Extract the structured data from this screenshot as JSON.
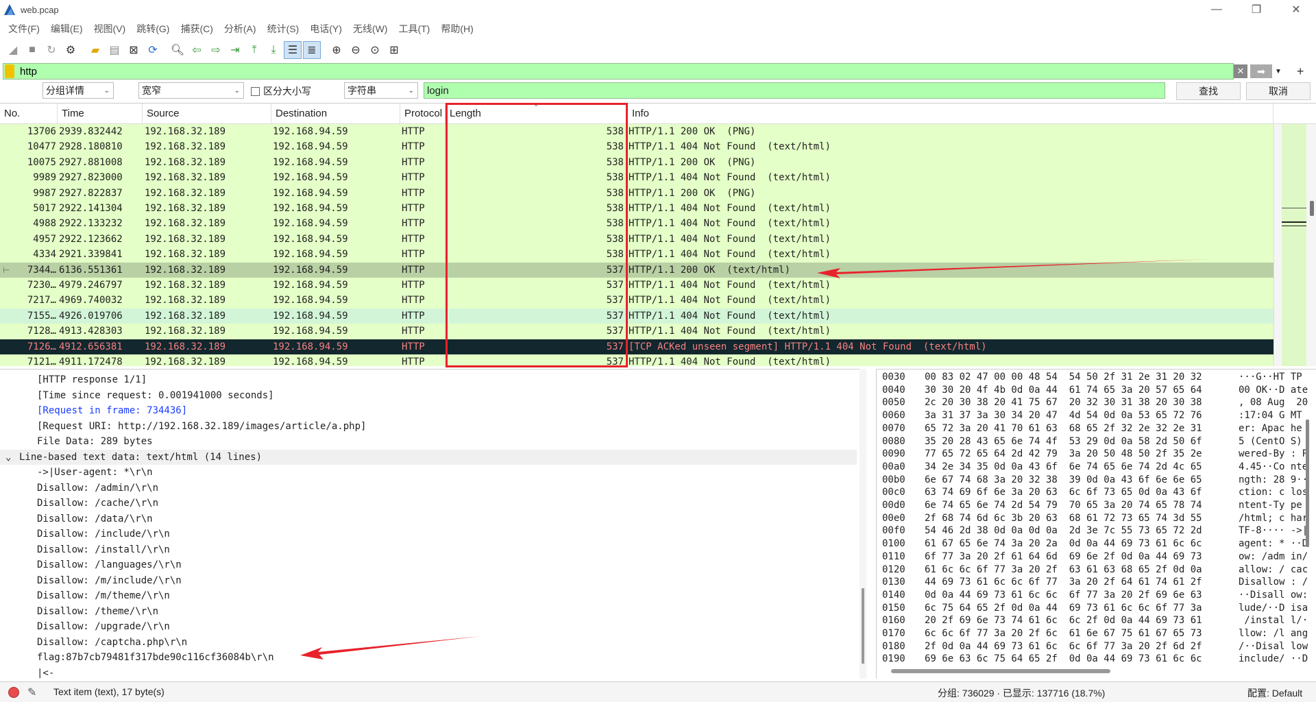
{
  "window": {
    "title": "web.pcap"
  },
  "menu": [
    "文件(F)",
    "编辑(E)",
    "视图(V)",
    "跳转(G)",
    "捕获(C)",
    "分析(A)",
    "统计(S)",
    "电话(Y)",
    "无线(W)",
    "工具(T)",
    "帮助(H)"
  ],
  "filter": {
    "value": "http"
  },
  "find": {
    "scope": "分组详情",
    "charset": "宽窄",
    "case_label": "区分大小写",
    "type": "字符串",
    "value": "login",
    "find_button": "查找",
    "cancel_button": "取消"
  },
  "packet_list": {
    "columns": [
      "No.",
      "Time",
      "Source",
      "Destination",
      "Protocol",
      "Length",
      "Info"
    ],
    "rows": [
      {
        "no": "13706",
        "time": "2939.832442",
        "src": "192.168.32.189",
        "dst": "192.168.94.59",
        "proto": "HTTP",
        "len": "538",
        "info": "HTTP/1.1 200 OK  (PNG)"
      },
      {
        "no": "10477",
        "time": "2928.180810",
        "src": "192.168.32.189",
        "dst": "192.168.94.59",
        "proto": "HTTP",
        "len": "538",
        "info": "HTTP/1.1 404 Not Found  (text/html)"
      },
      {
        "no": "10075",
        "time": "2927.881008",
        "src": "192.168.32.189",
        "dst": "192.168.94.59",
        "proto": "HTTP",
        "len": "538",
        "info": "HTTP/1.1 200 OK  (PNG)"
      },
      {
        "no": "9989",
        "time": "2927.823000",
        "src": "192.168.32.189",
        "dst": "192.168.94.59",
        "proto": "HTTP",
        "len": "538",
        "info": "HTTP/1.1 404 Not Found  (text/html)"
      },
      {
        "no": "9987",
        "time": "2927.822837",
        "src": "192.168.32.189",
        "dst": "192.168.94.59",
        "proto": "HTTP",
        "len": "538",
        "info": "HTTP/1.1 200 OK  (PNG)"
      },
      {
        "no": "5017",
        "time": "2922.141304",
        "src": "192.168.32.189",
        "dst": "192.168.94.59",
        "proto": "HTTP",
        "len": "538",
        "info": "HTTP/1.1 404 Not Found  (text/html)"
      },
      {
        "no": "4988",
        "time": "2922.133232",
        "src": "192.168.32.189",
        "dst": "192.168.94.59",
        "proto": "HTTP",
        "len": "538",
        "info": "HTTP/1.1 404 Not Found  (text/html)"
      },
      {
        "no": "4957",
        "time": "2922.123662",
        "src": "192.168.32.189",
        "dst": "192.168.94.59",
        "proto": "HTTP",
        "len": "538",
        "info": "HTTP/1.1 404 Not Found  (text/html)"
      },
      {
        "no": "4334",
        "time": "2921.339841",
        "src": "192.168.32.189",
        "dst": "192.168.94.59",
        "proto": "HTTP",
        "len": "538",
        "info": "HTTP/1.1 404 Not Found  (text/html)"
      },
      {
        "no": "7344…",
        "time": "6136.551361",
        "src": "192.168.32.189",
        "dst": "192.168.94.59",
        "proto": "HTTP",
        "len": "537",
        "info": "HTTP/1.1 200 OK  (text/html)",
        "style": "selected"
      },
      {
        "no": "7230…",
        "time": "4979.246797",
        "src": "192.168.32.189",
        "dst": "192.168.94.59",
        "proto": "HTTP",
        "len": "537",
        "info": "HTTP/1.1 404 Not Found  (text/html)"
      },
      {
        "no": "7217…",
        "time": "4969.740032",
        "src": "192.168.32.189",
        "dst": "192.168.94.59",
        "proto": "HTTP",
        "len": "537",
        "info": "HTTP/1.1 404 Not Found  (text/html)"
      },
      {
        "no": "7155…",
        "time": "4926.019706",
        "src": "192.168.32.189",
        "dst": "192.168.94.59",
        "proto": "HTTP",
        "len": "537",
        "info": "HTTP/1.1 404 Not Found  (text/html)",
        "style": "blue"
      },
      {
        "no": "7128…",
        "time": "4913.428303",
        "src": "192.168.32.189",
        "dst": "192.168.94.59",
        "proto": "HTTP",
        "len": "537",
        "info": "HTTP/1.1 404 Not Found  (text/html)"
      },
      {
        "no": "7126…",
        "time": "4912.656381",
        "src": "192.168.32.189",
        "dst": "192.168.94.59",
        "proto": "HTTP",
        "len": "537",
        "info": "[TCP ACKed unseen segment] HTTP/1.1 404 Not Found  (text/html)",
        "style": "dark"
      },
      {
        "no": "7121…",
        "time": "4911.172478",
        "src": "192.168.32.189",
        "dst": "192.168.94.59",
        "proto": "HTTP",
        "len": "537",
        "info": "HTTP/1.1 404 Not Found  (text/html)"
      }
    ]
  },
  "details": [
    {
      "text": "[HTTP response 1/1]",
      "indent": 2
    },
    {
      "text": "[Time since request: 0.001941000 seconds]",
      "indent": 2
    },
    {
      "text": "[Request in frame: 734436]",
      "indent": 2,
      "link": true
    },
    {
      "text": "[Request URI: http://192.168.32.189/images/article/a.php]",
      "indent": 2
    },
    {
      "text": "File Data: 289 bytes",
      "indent": 2
    },
    {
      "text": "Line-based text data: text/html (14 lines)",
      "indent": 1,
      "group": true,
      "expander": "⌄"
    },
    {
      "text": "->|User-agent: *\\r\\n",
      "indent": 2
    },
    {
      "text": "Disallow: /admin/\\r\\n",
      "indent": 2
    },
    {
      "text": "Disallow: /cache/\\r\\n",
      "indent": 2
    },
    {
      "text": "Disallow: /data/\\r\\n",
      "indent": 2
    },
    {
      "text": "Disallow: /include/\\r\\n",
      "indent": 2
    },
    {
      "text": "Disallow: /install/\\r\\n",
      "indent": 2
    },
    {
      "text": "Disallow: /languages/\\r\\n",
      "indent": 2
    },
    {
      "text": "Disallow: /m/include/\\r\\n",
      "indent": 2
    },
    {
      "text": "Disallow: /m/theme/\\r\\n",
      "indent": 2
    },
    {
      "text": "Disallow: /theme/\\r\\n",
      "indent": 2
    },
    {
      "text": "Disallow: /upgrade/\\r\\n",
      "indent": 2
    },
    {
      "text": "Disallow: /captcha.php\\r\\n",
      "indent": 2
    },
    {
      "text": "flag:87b7cb79481f317bde90c116cf36084b\\r\\n",
      "indent": 2
    },
    {
      "text": "|<-",
      "indent": 2
    }
  ],
  "bytes": [
    {
      "off": "0030",
      "hex": "00 83 02 47 00 00 48 54  54 50 2f 31 2e 31 20 32",
      "asc": "···G··HT TP"
    },
    {
      "off": "0040",
      "hex": "30 30 20 4f 4b 0d 0a 44  61 74 65 3a 20 57 65 64",
      "asc": "00 OK··D ate"
    },
    {
      "off": "0050",
      "hex": "2c 20 30 38 20 41 75 67  20 32 30 31 38 20 30 38",
      "asc": ", 08 Aug  20"
    },
    {
      "off": "0060",
      "hex": "3a 31 37 3a 30 34 20 47  4d 54 0d 0a 53 65 72 76",
      "asc": ":17:04 G MT"
    },
    {
      "off": "0070",
      "hex": "65 72 3a 20 41 70 61 63  68 65 2f 32 2e 32 2e 31",
      "asc": "er: Apac he"
    },
    {
      "off": "0080",
      "hex": "35 20 28 43 65 6e 74 4f  53 29 0d 0a 58 2d 50 6f",
      "asc": "5 (CentO S)"
    },
    {
      "off": "0090",
      "hex": "77 65 72 65 64 2d 42 79  3a 20 50 48 50 2f 35 2e",
      "asc": "wered-By : P"
    },
    {
      "off": "00a0",
      "hex": "34 2e 34 35 0d 0a 43 6f  6e 74 65 6e 74 2d 4c 65",
      "asc": "4.45··Co nte"
    },
    {
      "off": "00b0",
      "hex": "6e 67 74 68 3a 20 32 38  39 0d 0a 43 6f 6e 6e 65",
      "asc": "ngth: 28 9··"
    },
    {
      "off": "00c0",
      "hex": "63 74 69 6f 6e 3a 20 63  6c 6f 73 65 0d 0a 43 6f",
      "asc": "ction: c los"
    },
    {
      "off": "00d0",
      "hex": "6e 74 65 6e 74 2d 54 79  70 65 3a 20 74 65 78 74",
      "asc": "ntent-Ty pe"
    },
    {
      "off": "00e0",
      "hex": "2f 68 74 6d 6c 3b 20 63  68 61 72 73 65 74 3d 55",
      "asc": "/html; c har"
    },
    {
      "off": "00f0",
      "hex": "54 46 2d 38 0d 0a 0d 0a  2d 3e 7c 55 73 65 72 2d",
      "asc": "TF-8···· ->|"
    },
    {
      "off": "0100",
      "hex": "61 67 65 6e 74 3a 20 2a  0d 0a 44 69 73 61 6c 6c",
      "asc": "agent: * ··D"
    },
    {
      "off": "0110",
      "hex": "6f 77 3a 20 2f 61 64 6d  69 6e 2f 0d 0a 44 69 73",
      "asc": "ow: /adm in/"
    },
    {
      "off": "0120",
      "hex": "61 6c 6c 6f 77 3a 20 2f  63 61 63 68 65 2f 0d 0a",
      "asc": "allow: / cac"
    },
    {
      "off": "0130",
      "hex": "44 69 73 61 6c 6c 6f 77  3a 20 2f 64 61 74 61 2f",
      "asc": "Disallow : /"
    },
    {
      "off": "0140",
      "hex": "0d 0a 44 69 73 61 6c 6c  6f 77 3a 20 2f 69 6e 63",
      "asc": "··Disall ow:"
    },
    {
      "off": "0150",
      "hex": "6c 75 64 65 2f 0d 0a 44  69 73 61 6c 6c 6f 77 3a",
      "asc": "lude/··D isa"
    },
    {
      "off": "0160",
      "hex": "20 2f 69 6e 73 74 61 6c  6c 2f 0d 0a 44 69 73 61",
      "asc": " /instal l/·"
    },
    {
      "off": "0170",
      "hex": "6c 6c 6f 77 3a 20 2f 6c  61 6e 67 75 61 67 65 73",
      "asc": "llow: /l ang"
    },
    {
      "off": "0180",
      "hex": "2f 0d 0a 44 69 73 61 6c  6c 6f 77 3a 20 2f 6d 2f",
      "asc": "/··Disal low"
    },
    {
      "off": "0190",
      "hex": "69 6e 63 6c 75 64 65 2f  0d 0a 44 69 73 61 6c 6c",
      "asc": "include/ ··D"
    }
  ],
  "status": {
    "text": "Text item (text), 17 byte(s)",
    "count": "分组: 736029 · 已显示: 137716 (18.7%)",
    "profile": "配置: Default"
  },
  "colors": {
    "filter_bg": "#afffaf",
    "row_green": "#e4ffc7",
    "row_selected": "#b9d0a4",
    "row_dark": "#12272e",
    "annotation_red": "#e8212b"
  }
}
